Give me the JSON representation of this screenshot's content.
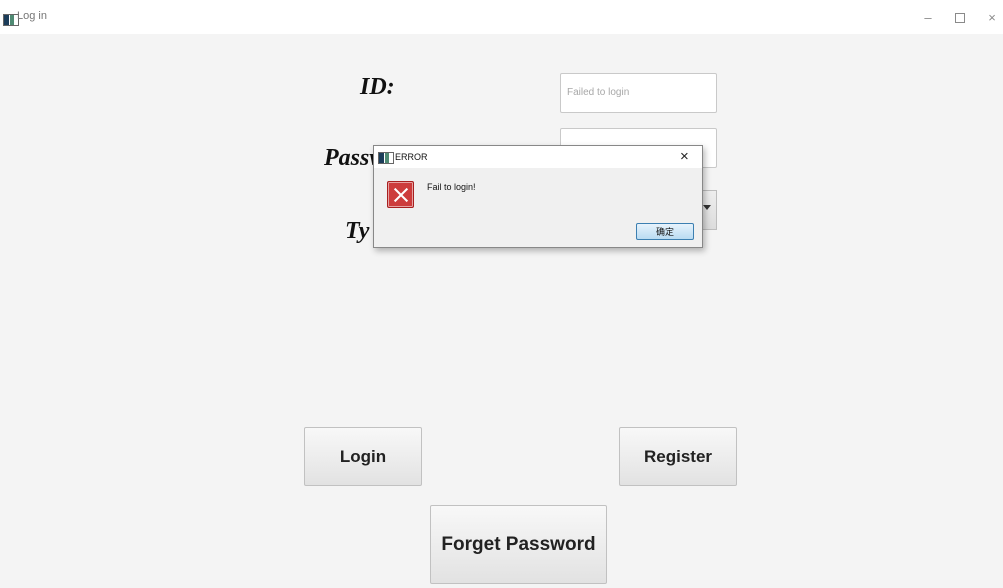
{
  "window": {
    "title": "Log in",
    "controls": {
      "minimize": "–",
      "close": "×"
    }
  },
  "form": {
    "id_label": "ID:",
    "password_label": "Passw",
    "type_label": "Ty",
    "id_field_value": "Failed to login",
    "password_field_value": ""
  },
  "buttons": {
    "login": "Login",
    "register": "Register",
    "forget_password": "Forget Password"
  },
  "dialog": {
    "title": "ERROR",
    "close": "×",
    "message": "Fail to login!",
    "ok_label": "确定",
    "icon": "error-icon"
  }
}
